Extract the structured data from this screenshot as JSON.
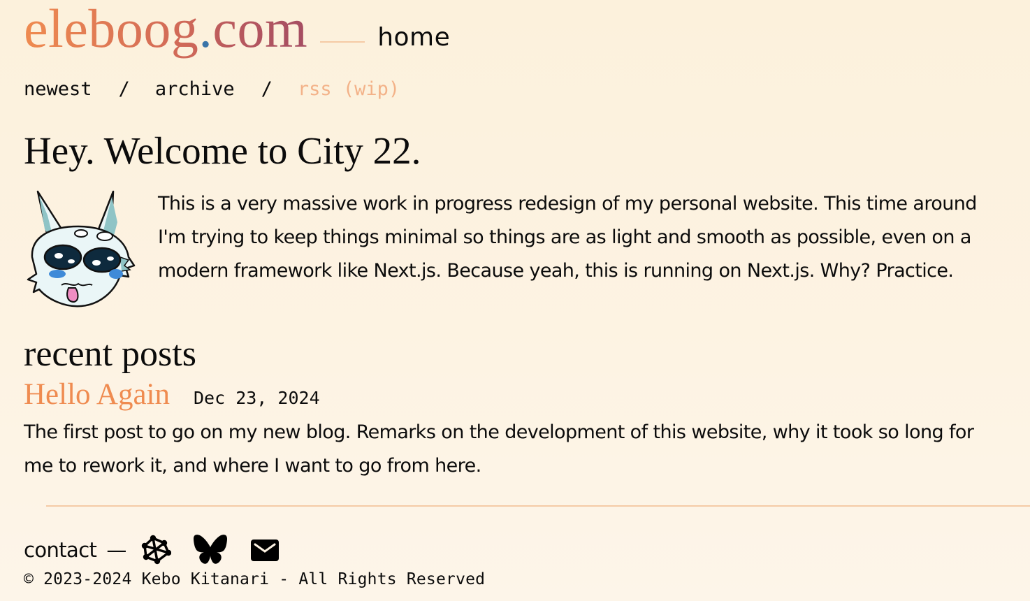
{
  "header": {
    "logo_name": "eleboog",
    "logo_dot": ".",
    "logo_tld": "com",
    "page_label": "home"
  },
  "nav": {
    "items": [
      {
        "label": "newest"
      },
      {
        "label": "archive"
      },
      {
        "label": "rss (wip)"
      }
    ],
    "separator": "/"
  },
  "intro": {
    "title": "Hey. Welcome to City 22.",
    "avatar_alt": "cartoon white fox-like creature head with blue ears",
    "body": "This is a very massive work in progress redesign of my personal website. This time around I'm trying to keep things minimal so things are as light and smooth as possible, even on a modern framework like Next.js. Because yeah, this is running on Next.js. Why? Practice."
  },
  "recent_posts": {
    "heading": "recent posts",
    "posts": [
      {
        "title": "Hello Again",
        "date": "Dec 23, 2024",
        "excerpt": "The first post to go on my new blog. Remarks on the development of this website, why it took so long for me to rework it, and where I want to go from here."
      }
    ]
  },
  "footer": {
    "contact_label": "contact",
    "contact_dash": "—",
    "icons": [
      {
        "name": "fediverse-icon"
      },
      {
        "name": "bluesky-butterfly-icon"
      },
      {
        "name": "mail-icon"
      }
    ],
    "copyright": "© 2023-2024 Kebo Kitanari - All Rights Reserved"
  },
  "colors": {
    "background": "#fcf1dc",
    "logo_gradient_start": "#ef8b50",
    "logo_gradient_end": "#9e4a63",
    "logo_dot": "#3a74a8",
    "accent": "#ef8b50",
    "muted_link": "#f3b288",
    "rule": "#f5cba6",
    "text": "#0b0b0b"
  }
}
